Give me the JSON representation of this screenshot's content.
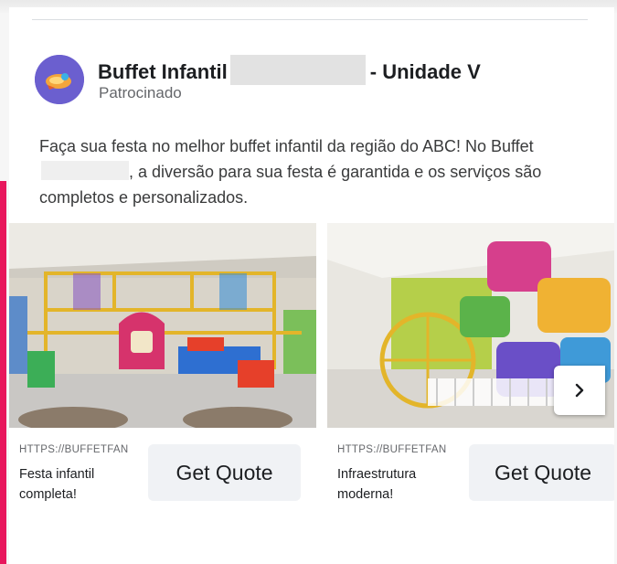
{
  "post": {
    "page_name_prefix": "Buffet Infantil",
    "page_name_suffix": "- Unidade V",
    "sponsored_label": "Patrocinado",
    "caption_start": "Faça sua festa no melhor buffet infantil da região do ABC! No Buffet",
    "caption_end": ", a diversão para sua festa é garantida e os serviços são completos e personalizados."
  },
  "carousel": {
    "items": [
      {
        "url": "HTTPS://BUFFETFAN",
        "title": "Festa infantil completa!",
        "cta_label": "Get Quote"
      },
      {
        "url": "HTTPS://BUFFETFAN",
        "title": "Infraestrutura moderna!",
        "cta_label": "Get Quote"
      }
    ],
    "next_icon": "chevron-right-icon"
  },
  "colors": {
    "accent": "#e8165c",
    "avatar": "#6b5fcf",
    "cta_background": "#f0f2f5",
    "secondary_text": "#65676b"
  }
}
